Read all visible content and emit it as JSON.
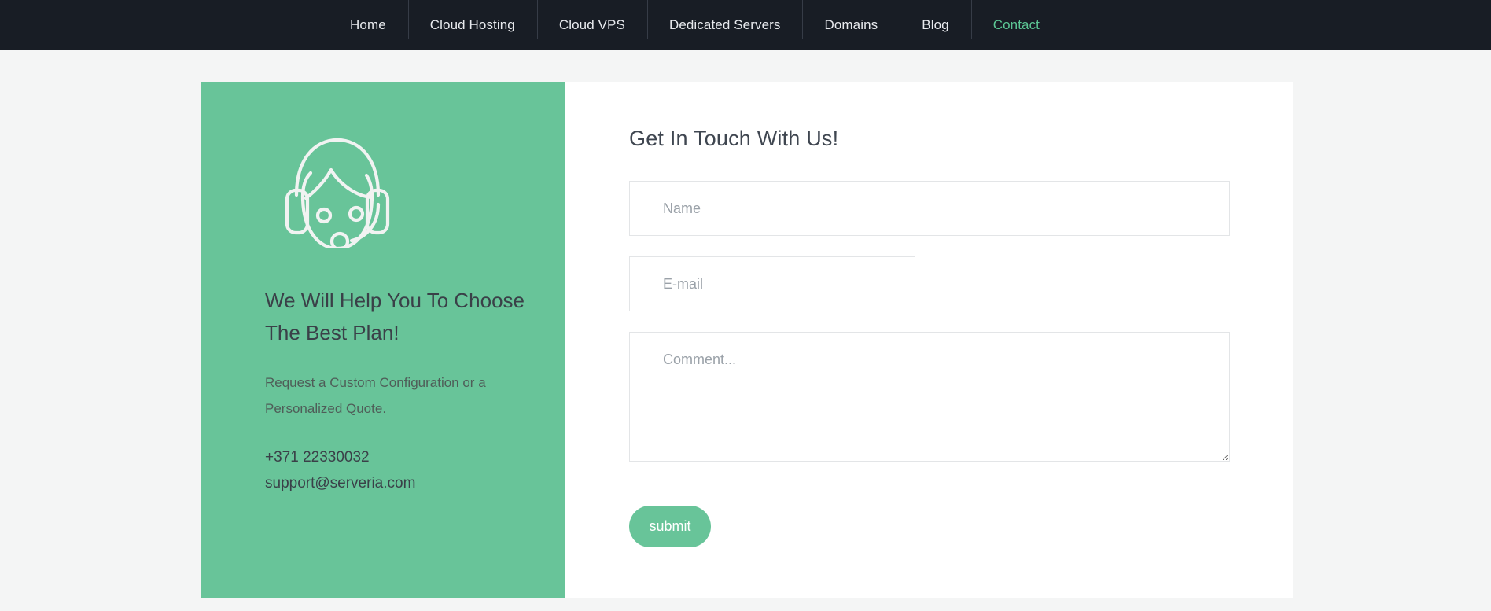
{
  "header": {
    "nav_items": [
      {
        "label": "Home",
        "active": false
      },
      {
        "label": "Cloud Hosting",
        "active": false
      },
      {
        "label": "Cloud VPS",
        "active": false
      },
      {
        "label": "Dedicated Servers",
        "active": false
      },
      {
        "label": "Domains",
        "active": false
      },
      {
        "label": "Blog",
        "active": false
      },
      {
        "label": "Contact",
        "active": true
      }
    ],
    "background_color": "#181d25",
    "link_color": "#e8eaee",
    "active_link_color": "#5cc795"
  },
  "info_panel": {
    "icon": "support-headset-icon",
    "title": "We Will Help You To Choose The Best Plan!",
    "description": "Request a Custom Configuration or a Personalized Quote.",
    "phone": "+371 22330032",
    "email": "support@serveria.com",
    "background_color": "#68c499"
  },
  "form": {
    "title": "Get In Touch With Us!",
    "name_placeholder": "Name",
    "name_value": "",
    "email_placeholder": "E-mail",
    "email_value": "",
    "comment_placeholder": "Comment...",
    "comment_value": "",
    "submit_label": "submit",
    "submit_color": "#68c499"
  },
  "page": {
    "background_color": "#f4f5f5",
    "card_background": "#ffffff"
  }
}
